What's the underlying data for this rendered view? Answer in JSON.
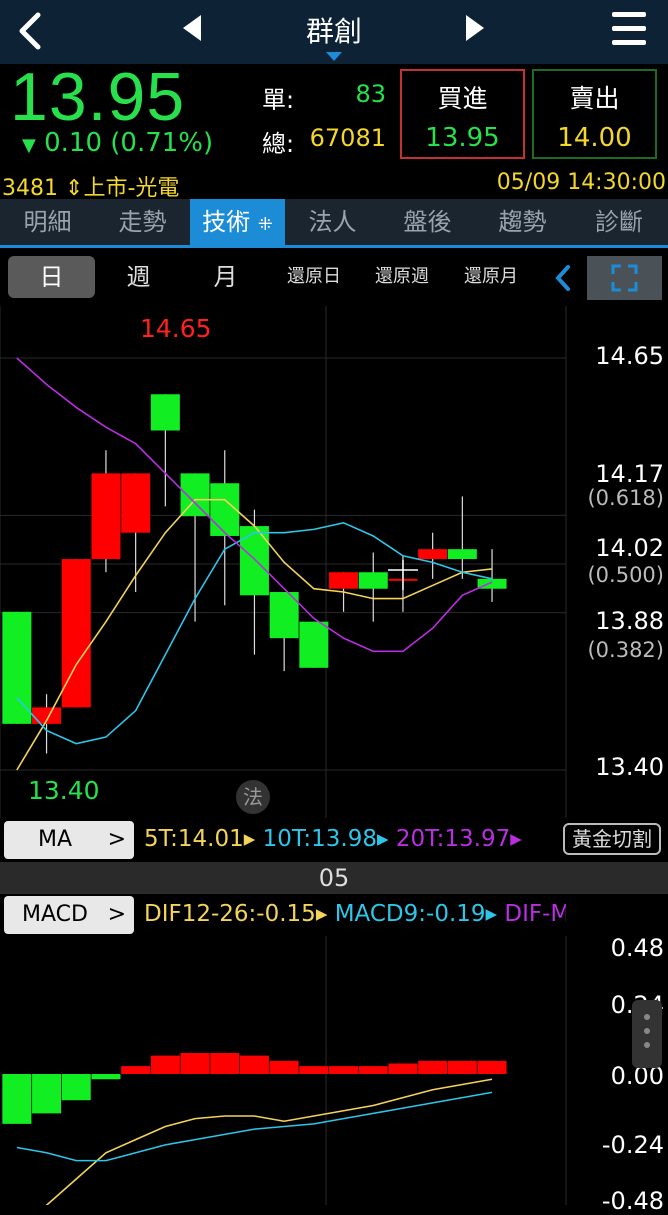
{
  "header": {
    "title": "群創"
  },
  "quote": {
    "price": "13.95",
    "change": "0.10 (0.71%)",
    "single_label": "單:",
    "single_value": "83",
    "total_label": "總:",
    "total_value": "67081",
    "buy_label": "買進",
    "buy_price": "13.95",
    "sell_label": "賣出",
    "sell_price": "14.00",
    "stock_code": "3481",
    "market": "上市-光電",
    "datetime": "05/09 14:30:00"
  },
  "tabs": [
    "明細",
    "走勢",
    "技術",
    "法人",
    "盤後",
    "趨勢",
    "診斷"
  ],
  "periods": [
    "日",
    "週",
    "月",
    "還原日",
    "還原週",
    "還原月"
  ],
  "chart_labels": {
    "high": "14.65",
    "low": "13.40",
    "fa_badge": "法"
  },
  "price_axis": [
    {
      "value": "14.65"
    },
    {
      "value": "14.17",
      "ratio": "(0.618)"
    },
    {
      "value": "14.02",
      "ratio": "(0.500)"
    },
    {
      "value": "13.88",
      "ratio": "(0.382)"
    },
    {
      "value": "13.40"
    }
  ],
  "ma_row": {
    "button": "MA",
    "ma5": "5T:14.01",
    "ma10": "10T:13.98",
    "ma20": "20T:13.97",
    "golden": "黃金切割"
  },
  "date_marker": "05",
  "macd_row": {
    "button": "MACD",
    "dif": "DIF12-26:-0.15",
    "macd": "MACD9:-0.19",
    "osc": "DIF-M"
  },
  "macd_axis": [
    "0.48",
    "0.24",
    "0.00",
    "-0.24",
    "-0.48"
  ],
  "colors": {
    "up": "#ff0000",
    "down": "#11ee22",
    "ma5": "#f3d35a",
    "ma10": "#2ec5e8",
    "ma20": "#b82ee0",
    "accent": "#1c8cd6"
  },
  "chart_data": [
    {
      "type": "candlestick",
      "y_range": [
        13.4,
        14.65
      ],
      "candles": [
        {
          "o": 13.88,
          "h": 13.88,
          "c": 13.54,
          "l": 13.54
        },
        {
          "o": 13.54,
          "h": 13.63,
          "c": 13.59,
          "l": 13.45
        },
        {
          "o": 13.59,
          "h": 14.02,
          "c": 14.04,
          "l": 13.59
        },
        {
          "o": 14.04,
          "h": 14.37,
          "c": 14.3,
          "l": 14.0
        },
        {
          "o": 14.12,
          "h": 14.3,
          "c": 14.3,
          "l": 13.94
        },
        {
          "o": 14.54,
          "h": 14.54,
          "c": 14.43,
          "l": 14.2
        },
        {
          "o": 14.3,
          "h": 14.27,
          "c": 14.17,
          "l": 13.85
        },
        {
          "o": 14.27,
          "h": 14.37,
          "c": 14.11,
          "l": 13.9
        },
        {
          "o": 14.14,
          "h": 14.19,
          "c": 13.93,
          "l": 13.75
        },
        {
          "o": 13.94,
          "h": 13.94,
          "c": 13.8,
          "l": 13.7
        },
        {
          "o": 13.85,
          "h": 13.85,
          "c": 13.71,
          "l": 13.71
        },
        {
          "o": 13.95,
          "h": 14.0,
          "c": 14.0,
          "l": 13.88
        },
        {
          "o": 14.0,
          "h": 14.06,
          "c": 13.95,
          "l": 13.85
        },
        {
          "o": 13.98,
          "h": 14.05,
          "c": 13.98,
          "l": 13.88
        },
        {
          "o": 14.04,
          "h": 14.12,
          "c": 14.07,
          "l": 13.98
        },
        {
          "o": 14.07,
          "h": 14.23,
          "c": 14.04,
          "l": 13.98
        },
        {
          "o": 13.98,
          "h": 14.07,
          "c": 13.95,
          "l": 13.91
        }
      ],
      "ma5": [
        13.4,
        13.55,
        13.72,
        13.85,
        13.99,
        14.12,
        14.22,
        14.22,
        14.14,
        14.03,
        13.95,
        13.94,
        13.92,
        13.92,
        13.96,
        14.0,
        14.01
      ],
      "ma10": [
        13.62,
        13.52,
        13.48,
        13.5,
        13.58,
        13.75,
        13.92,
        14.07,
        14.12,
        14.12,
        14.13,
        14.15,
        14.11,
        14.05,
        14.03,
        14.0,
        13.98
      ],
      "ma20": [
        14.65,
        14.57,
        14.5,
        14.44,
        14.39,
        14.3,
        14.21,
        14.12,
        14.04,
        13.95,
        13.86,
        13.8,
        13.76,
        13.76,
        13.83,
        13.93,
        13.97
      ]
    },
    {
      "type": "bar",
      "title": "MACD",
      "y_range": [
        -0.48,
        0.48
      ],
      "osc": [
        -0.19,
        -0.15,
        -0.1,
        -0.02,
        0.03,
        0.07,
        0.08,
        0.08,
        0.07,
        0.05,
        0.03,
        0.03,
        0.03,
        0.04,
        0.05,
        0.05,
        0.05
      ],
      "dif": [
        -0.6,
        -0.5,
        -0.4,
        -0.3,
        -0.25,
        -0.2,
        -0.17,
        -0.16,
        -0.16,
        -0.18,
        -0.16,
        -0.14,
        -0.12,
        -0.09,
        -0.06,
        -0.04,
        -0.02
      ],
      "dea": [
        -0.28,
        -0.3,
        -0.33,
        -0.33,
        -0.3,
        -0.27,
        -0.25,
        -0.23,
        -0.21,
        -0.2,
        -0.19,
        -0.17,
        -0.15,
        -0.13,
        -0.11,
        -0.09,
        -0.07
      ]
    }
  ]
}
